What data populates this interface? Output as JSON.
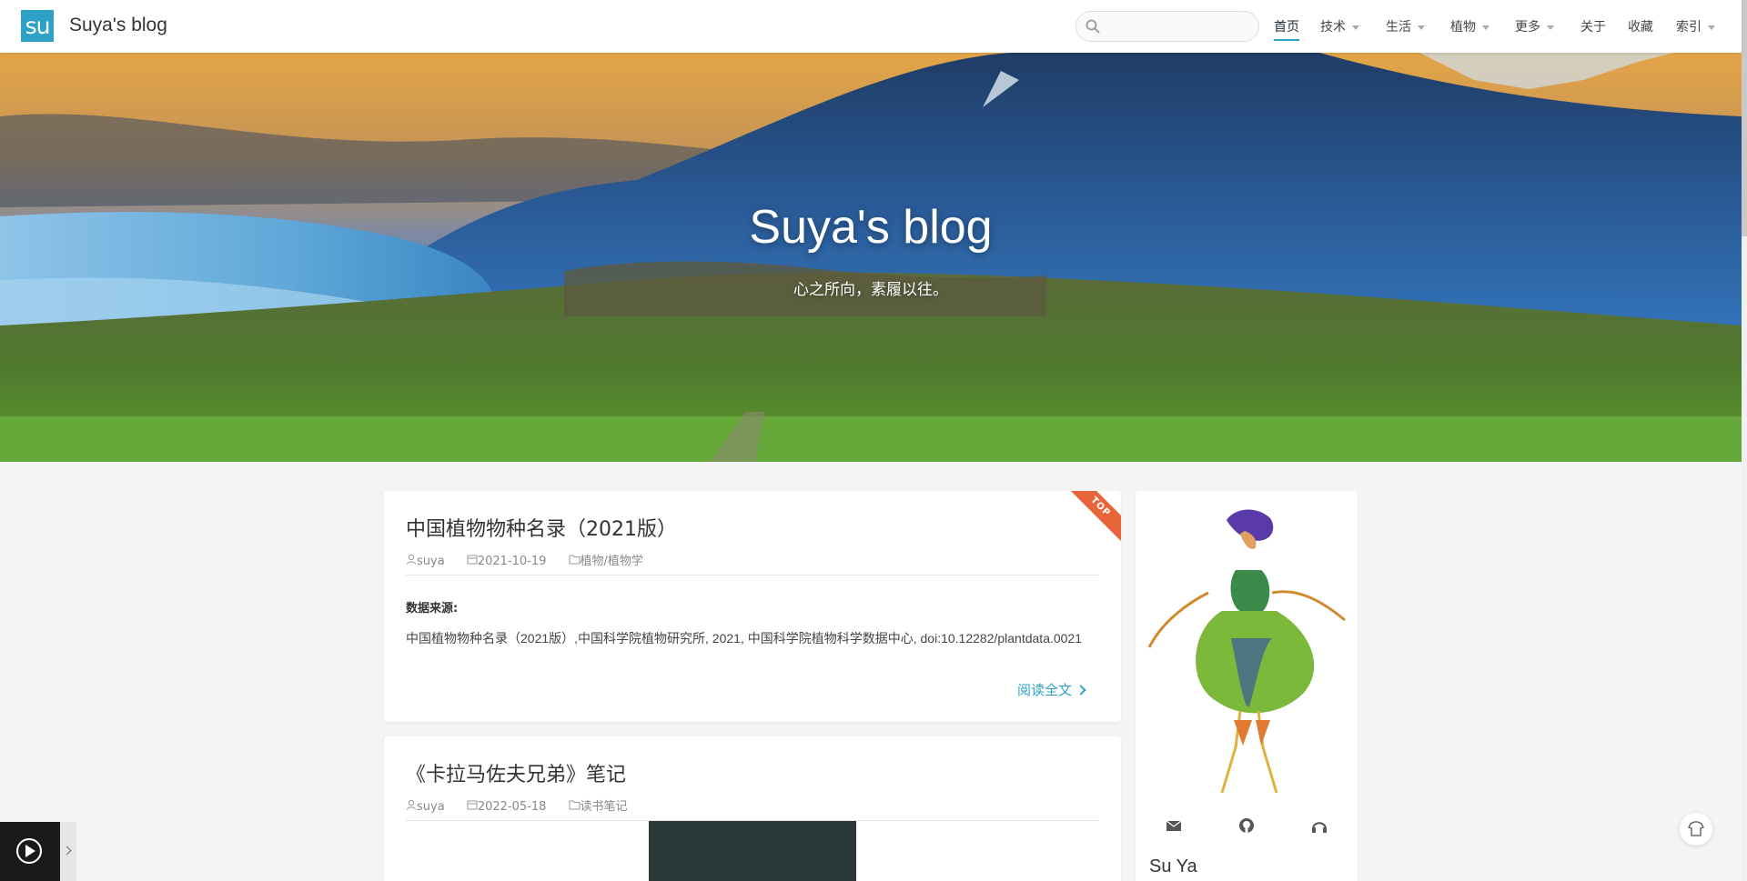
{
  "header": {
    "logo_text": "su",
    "site_name": "Suya's blog",
    "search_placeholder": "",
    "nav": [
      {
        "label": "首页",
        "active": true,
        "dropdown": false
      },
      {
        "label": "技术",
        "active": false,
        "dropdown": true
      },
      {
        "label": "生活",
        "active": false,
        "dropdown": true
      },
      {
        "label": "植物",
        "active": false,
        "dropdown": true
      },
      {
        "label": "更多",
        "active": false,
        "dropdown": true
      },
      {
        "label": "关于",
        "active": false,
        "dropdown": false
      },
      {
        "label": "收藏",
        "active": false,
        "dropdown": false
      },
      {
        "label": "索引",
        "active": false,
        "dropdown": true
      }
    ]
  },
  "hero": {
    "title": "Suya's blog",
    "subtitle": "心之所向，素履以往。"
  },
  "posts": [
    {
      "title": "中国植物物种名录（2021版）",
      "author": "suya",
      "date": "2021-10-19",
      "category": "植物/植物学",
      "badge": "TOP",
      "excerpt_label": "数据来源:",
      "excerpt": "中国植物物种名录（2021版）,中国科学院植物研究所, 2021, 中国科学院植物科学数据中心, doi:10.12282/plantdata.0021",
      "read_more": "阅读全文"
    },
    {
      "title": "《卡拉马佐夫兄弟》笔记",
      "author": "suya",
      "date": "2022-05-18",
      "category": "读书笔记"
    }
  ],
  "profile": {
    "name": "Su Ya",
    "icons": [
      "mail-icon",
      "github-icon",
      "headphones-icon"
    ]
  },
  "colors": {
    "accent": "#2ea1c7",
    "ribbon": "#e8653a"
  }
}
